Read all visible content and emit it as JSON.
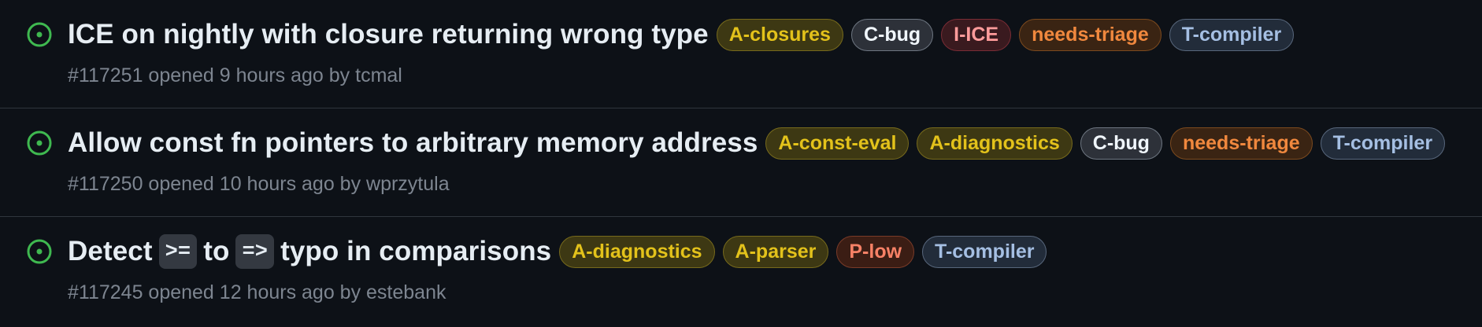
{
  "issues": [
    {
      "title_parts": [
        {
          "type": "text",
          "value": "ICE on nightly with closure returning wrong type"
        }
      ],
      "labels": [
        {
          "name": "A-closures",
          "color": "yellow"
        },
        {
          "name": "C-bug",
          "color": "gray"
        },
        {
          "name": "I-ICE",
          "color": "red"
        },
        {
          "name": "needs-triage",
          "color": "orange"
        },
        {
          "name": "T-compiler",
          "color": "blue"
        }
      ],
      "meta": "#117251 opened 9 hours ago by tcmal"
    },
    {
      "title_parts": [
        {
          "type": "text",
          "value": "Allow const fn pointers to arbitrary memory address"
        }
      ],
      "labels": [
        {
          "name": "A-const-eval",
          "color": "yellow"
        },
        {
          "name": "A-diagnostics",
          "color": "yellow"
        },
        {
          "name": "C-bug",
          "color": "gray"
        },
        {
          "name": "needs-triage",
          "color": "orange"
        },
        {
          "name": "T-compiler",
          "color": "blue"
        }
      ],
      "meta": "#117250 opened 10 hours ago by wprzytula"
    },
    {
      "title_parts": [
        {
          "type": "text",
          "value": "Detect"
        },
        {
          "type": "code",
          "value": ">="
        },
        {
          "type": "text",
          "value": "to"
        },
        {
          "type": "code",
          "value": "=>"
        },
        {
          "type": "text",
          "value": "typo in comparisons"
        }
      ],
      "labels": [
        {
          "name": "A-diagnostics",
          "color": "yellow"
        },
        {
          "name": "A-parser",
          "color": "yellow"
        },
        {
          "name": "P-low",
          "color": "plow"
        },
        {
          "name": "T-compiler",
          "color": "blue"
        }
      ],
      "meta": "#117245 opened 12 hours ago by estebank"
    }
  ],
  "icon": {
    "name": "issue-opened-icon",
    "color": "#3fb950"
  }
}
